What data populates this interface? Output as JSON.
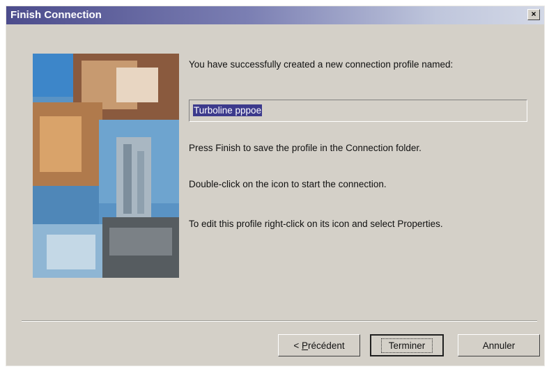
{
  "window": {
    "title": "Finish Connection",
    "close_label": "×"
  },
  "picture": {
    "icon": "connection-wizard-collage"
  },
  "content": {
    "intro": "You have successfully created a new connection profile named:",
    "profile_name": "Turboline pppoe",
    "line_finish": "Press Finish to save the profile in the Connection folder.",
    "line_doubleclick": "Double-click on the icon to start the connection.",
    "line_edit": "To edit this profile right-click on its icon and select Properties."
  },
  "buttons": {
    "back_prefix": "< ",
    "back_mnemonic": "P",
    "back_rest": "récédent",
    "finish": "Terminer",
    "cancel": "Annuler"
  }
}
